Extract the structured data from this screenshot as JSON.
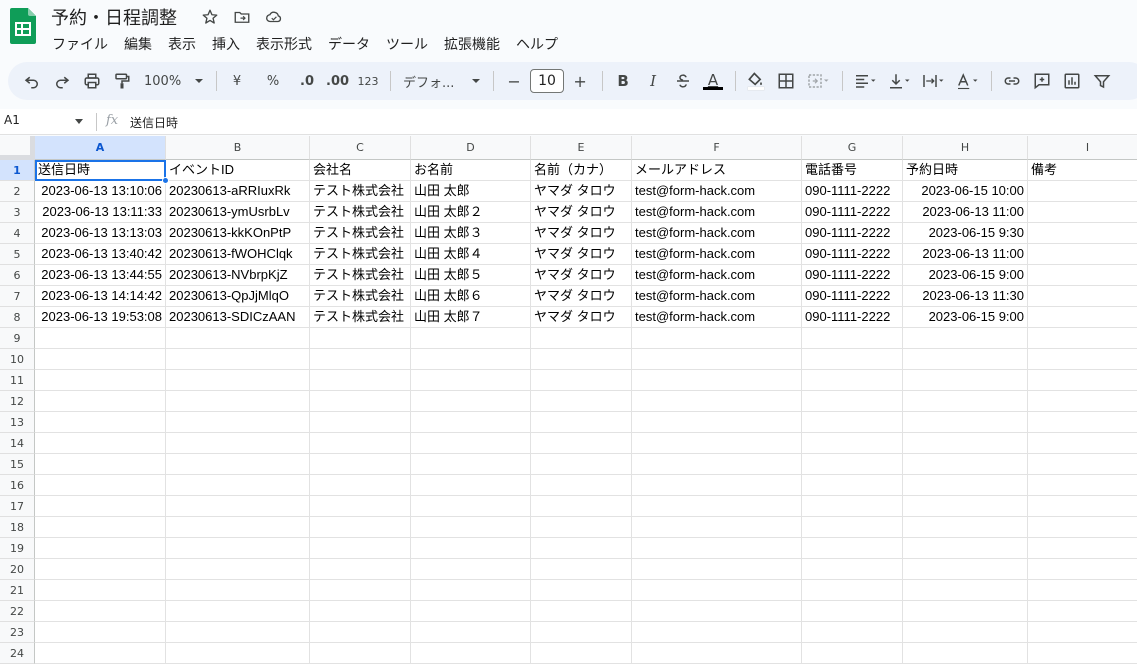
{
  "app": {
    "title": "予約・日程調整",
    "brand_color": "#0f9d58"
  },
  "title_icons": [
    "star-icon",
    "move-folder-icon",
    "cloud-status-icon"
  ],
  "menu": [
    "ファイル",
    "編集",
    "表示",
    "挿入",
    "表示形式",
    "データ",
    "ツール",
    "拡張機能",
    "ヘルプ"
  ],
  "toolbar": {
    "zoom": "100%",
    "currency": "¥",
    "percent": "%",
    "decrease_decimal": ".0",
    "increase_decimal": ".00",
    "number_format": "123",
    "font": "デフォ...",
    "font_size": "10",
    "font_size_minus": "−",
    "font_size_plus": "+",
    "bold": "B",
    "italic": "I",
    "text_color": "A"
  },
  "formula_bar": {
    "cell_ref": "A1",
    "fx": "fx",
    "content": "送信日時"
  },
  "columns": [
    "A",
    "B",
    "C",
    "D",
    "E",
    "F",
    "G",
    "H",
    "I"
  ],
  "row_numbers": [
    "1",
    "2",
    "3",
    "4",
    "5",
    "6",
    "7",
    "8",
    "9",
    "10",
    "11",
    "12",
    "13",
    "14",
    "15",
    "16",
    "17",
    "18",
    "19",
    "20",
    "21",
    "22",
    "23",
    "24"
  ],
  "sheet": {
    "header": [
      "送信日時",
      "イベントID",
      "会社名",
      "お名前",
      "名前（カナ）",
      "メールアドレス",
      "電話番号",
      "予約日時",
      "備考"
    ],
    "rows": [
      [
        "2023-06-13 13:10:06",
        "20230613-aRRIuxRk",
        "テスト株式会社",
        "山田 太郎",
        "ヤマダ タロウ",
        "test@form-hack.com",
        "090-1111-2222",
        "2023-06-15 10:00",
        ""
      ],
      [
        "2023-06-13 13:11:33",
        "20230613-ymUsrbLv",
        "テスト株式会社",
        "山田 太郎２",
        "ヤマダ タロウ",
        "test@form-hack.com",
        "090-1111-2222",
        "2023-06-13 11:00",
        ""
      ],
      [
        "2023-06-13 13:13:03",
        "20230613-kkKOnPtP",
        "テスト株式会社",
        "山田 太郎３",
        "ヤマダ タロウ",
        "test@form-hack.com",
        "090-1111-2222",
        "2023-06-15 9:30",
        ""
      ],
      [
        "2023-06-13 13:40:42",
        "20230613-fWOHClqk",
        "テスト株式会社",
        "山田 太郎４",
        "ヤマダ タロウ",
        "test@form-hack.com",
        "090-1111-2222",
        "2023-06-13 11:00",
        ""
      ],
      [
        "2023-06-13 13:44:55",
        "20230613-NVbrpKjZ",
        "テスト株式会社",
        "山田 太郎５",
        "ヤマダ タロウ",
        "test@form-hack.com",
        "090-1111-2222",
        "2023-06-15 9:00",
        ""
      ],
      [
        "2023-06-13 14:14:42",
        "20230613-QpJjMlqO",
        "テスト株式会社",
        "山田 太郎６",
        "ヤマダ タロウ",
        "test@form-hack.com",
        "090-1111-2222",
        "2023-06-13 11:30",
        ""
      ],
      [
        "2023-06-13 19:53:08",
        "20230613-SDICzAAN",
        "テスト株式会社",
        "山田 太郎７",
        "ヤマダ タロウ",
        "test@form-hack.com",
        "090-1111-2222",
        "2023-06-15 9:00",
        ""
      ]
    ]
  }
}
